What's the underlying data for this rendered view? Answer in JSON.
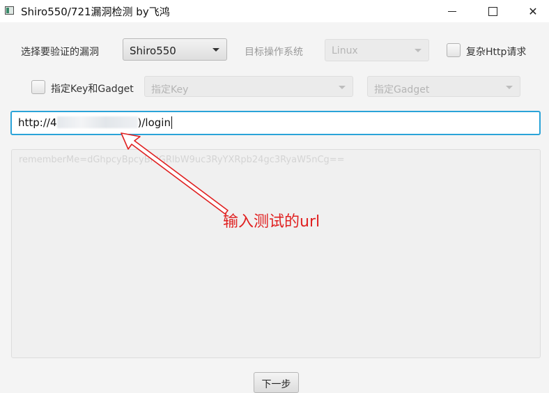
{
  "window": {
    "title": "Shiro550/721漏洞检测  by飞鸿",
    "minimize_label": "",
    "maximize_label": "",
    "close_label": "✕"
  },
  "options": {
    "vuln_label": "选择要验证的漏洞",
    "vuln_selected": "Shiro550",
    "os_label": "目标操作系统",
    "os_selected": "Linux",
    "complex_http_label": "复杂Http请求",
    "complex_http_checked": false,
    "key_gadget_label": "指定Key和Gadget",
    "key_gadget_checked": false,
    "key_placeholder": "指定Key",
    "gadget_placeholder": "指定Gadget"
  },
  "url_input": {
    "prefix": "http://4",
    "suffix": ")/login"
  },
  "result_area": {
    "placeholder": "rememberMe=dGhpcyBpcyBhIGRlbW9uc3RyYXRpb24gc3RyaW5nCg=="
  },
  "annotation": {
    "text": "输入测试的url",
    "color": "#e02020"
  },
  "buttons": {
    "next_label": "下一步"
  },
  "colors": {
    "focus_border": "#2aa3d8",
    "window_bg": "#f4f4f4"
  }
}
